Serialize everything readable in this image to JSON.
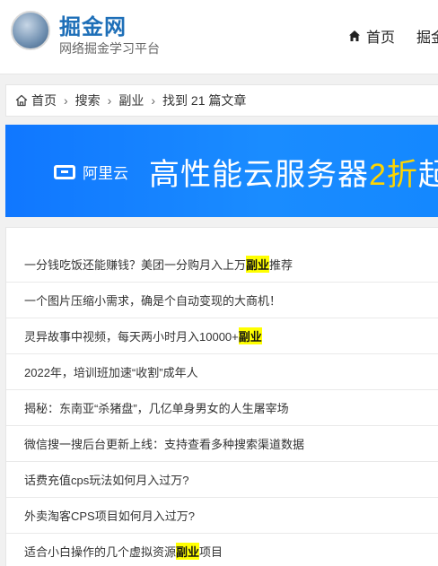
{
  "header": {
    "site_title": "掘金网",
    "site_subtitle": "网络掘金学习平台",
    "logo_icon": "handshake-logo-icon",
    "nav": [
      {
        "label": "首页",
        "icon": "home-icon"
      },
      {
        "label": "掘金"
      }
    ]
  },
  "breadcrumb": {
    "home": "首页",
    "items": [
      "搜索",
      "副业"
    ],
    "result": "找到 21 篇文章",
    "separator": "›"
  },
  "banner": {
    "brand": "阿里云",
    "text_prefix": "高性能云服务器",
    "text_accent": "2折",
    "text_suffix": "起",
    "accent_color": "#ffd500",
    "background_color": "#1a8cff"
  },
  "articles": [
    {
      "before": "一分钱吃饭还能赚钱？美团一分购月入上万",
      "highlight": "副业",
      "after": "推荐"
    },
    {
      "before": "一个图片压缩小需求，确是个自动变现的大商机！",
      "highlight": "",
      "after": ""
    },
    {
      "before": "灵异故事中视频，每天两小时月入10000+",
      "highlight": "副业",
      "after": ""
    },
    {
      "before": "2022年，培训班加速“收割”成年人",
      "highlight": "",
      "after": ""
    },
    {
      "before": "揭秘：东南亚“杀猪盘”，几亿单身男女的人生屠宰场",
      "highlight": "",
      "after": ""
    },
    {
      "before": "微信搜一搜后台更新上线：支持查看多种搜索渠道数据",
      "highlight": "",
      "after": ""
    },
    {
      "before": "话费充值cps玩法如何月入过万?",
      "highlight": "",
      "after": ""
    },
    {
      "before": "外卖淘客CPS项目如何月入过万?",
      "highlight": "",
      "after": ""
    },
    {
      "before": "适合小白操作的几个虚拟资源",
      "highlight": "副业",
      "after": "项目"
    }
  ],
  "highlight_color": "#ffff00"
}
